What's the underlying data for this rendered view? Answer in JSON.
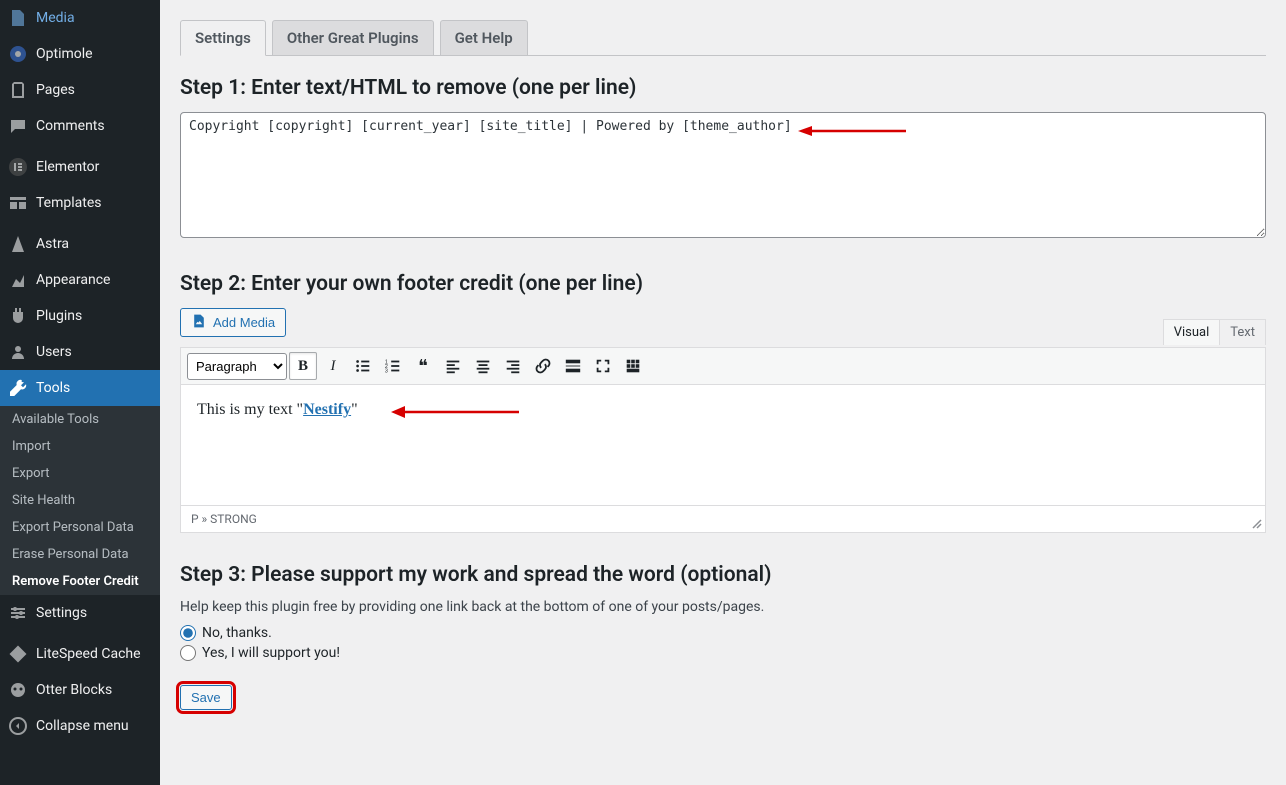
{
  "sidebar": {
    "items": [
      {
        "label": "Media",
        "icon": "media"
      },
      {
        "label": "Optimole",
        "icon": "optimole"
      },
      {
        "label": "Pages",
        "icon": "pages"
      },
      {
        "label": "Comments",
        "icon": "comments"
      },
      {
        "label": "Elementor",
        "icon": "elementor"
      },
      {
        "label": "Templates",
        "icon": "templates"
      },
      {
        "label": "Astra",
        "icon": "astra"
      },
      {
        "label": "Appearance",
        "icon": "appearance"
      },
      {
        "label": "Plugins",
        "icon": "plugins"
      },
      {
        "label": "Users",
        "icon": "users"
      },
      {
        "label": "Tools",
        "icon": "tools"
      }
    ],
    "submenu": [
      "Available Tools",
      "Import",
      "Export",
      "Site Health",
      "Export Personal Data",
      "Erase Personal Data",
      "Remove Footer Credit"
    ],
    "after": [
      {
        "label": "Settings",
        "icon": "settings"
      },
      {
        "label": "LiteSpeed Cache",
        "icon": "litespeed"
      },
      {
        "label": "Otter Blocks",
        "icon": "otter"
      },
      {
        "label": "Collapse menu",
        "icon": "collapse"
      }
    ]
  },
  "tabs": [
    "Settings",
    "Other Great Plugins",
    "Get Help"
  ],
  "step1": {
    "title": "Step 1: Enter text/HTML to remove (one per line)",
    "value": "Copyright [copyright] [current_year] [site_title] | Powered by [theme_author]"
  },
  "step2": {
    "title": "Step 2: Enter your own footer credit (one per line)",
    "addMedia": "Add Media",
    "modeVisual": "Visual",
    "modeText": "Text",
    "formatSelect": "Paragraph",
    "contentPrefix": "This is my text \"",
    "contentLink": "Nestify",
    "contentSuffix": "\"",
    "statusbar": "P » STRONG"
  },
  "step3": {
    "title": "Step 3: Please support my work and spread the word (optional)",
    "desc": "Help keep this plugin free by providing one link back at the bottom of one of your posts/pages.",
    "optionNo": "No, thanks.",
    "optionYes": "Yes, I will support you!"
  },
  "saveLabel": "Save"
}
